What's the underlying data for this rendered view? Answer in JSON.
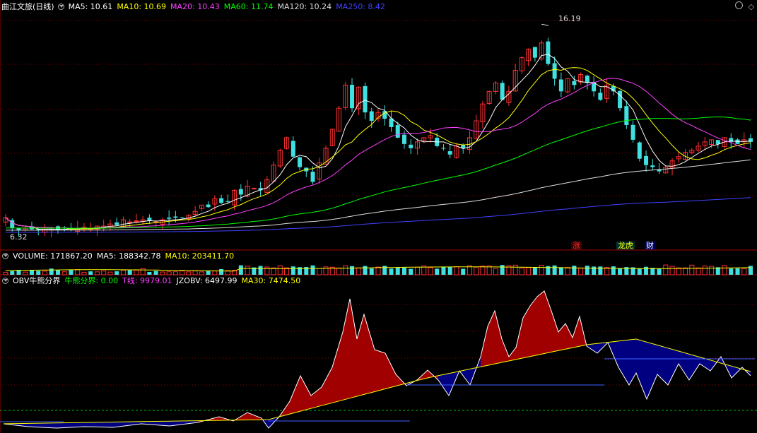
{
  "header": {
    "stock_name": "曲江文旅(日线)",
    "ma": [
      {
        "label": "MA5: 10.61",
        "color": "#ffffff"
      },
      {
        "label": "MA10: 10.69",
        "color": "#ffff00"
      },
      {
        "label": "MA20: 10.43",
        "color": "#ff40ff"
      },
      {
        "label": "MA60: 11.74",
        "color": "#00ff00"
      },
      {
        "label": "MA120: 10.24",
        "color": "#dddddd"
      },
      {
        "label": "MA250: 8.42",
        "color": "#4040ff"
      }
    ]
  },
  "volume_legend": [
    {
      "label": "VOLUME: 171867.20",
      "color": "#ffffff"
    },
    {
      "label": "MA5: 188342.78",
      "color": "#ffffff"
    },
    {
      "label": "MA10: 203411.70",
      "color": "#ffff00"
    }
  ],
  "obv_legend": [
    {
      "label": "OBV牛熊分界",
      "color": "#ffffff"
    },
    {
      "label": "牛熊分界: 0.00",
      "color": "#00ff00"
    },
    {
      "label": "T线: 9979.01",
      "color": "#ff40ff"
    },
    {
      "label": "JZOBV: 6497.99",
      "color": "#ffffff"
    },
    {
      "label": "MA30: 7474.50",
      "color": "#ffff00"
    }
  ],
  "annotations": {
    "high": "16.19",
    "low": "6.32",
    "events": [
      {
        "text": "涨",
        "color": "#ff3030",
        "bg": "#3a0000"
      },
      {
        "text": "龙虎",
        "color": "#ffff00",
        "bg": "#003030"
      },
      {
        "text": "财",
        "color": "#ffffff",
        "bg": "#000060"
      }
    ]
  },
  "colors": {
    "up": "#ff3030",
    "down": "#40e0e0",
    "grid": "#8b0000",
    "obv_up_fill": "#a00000",
    "obv_down_fill": "#000080"
  },
  "chart_data": {
    "type": "candlestick",
    "price_range": [
      6.0,
      16.6
    ],
    "closes": [
      7.0,
      6.5,
      6.4,
      6.5,
      6.45,
      6.4,
      6.5,
      6.45,
      6.4,
      6.5,
      6.45,
      6.5,
      6.55,
      6.5,
      6.6,
      6.6,
      6.7,
      6.65,
      6.9,
      6.8,
      6.85,
      6.9,
      6.85,
      6.8,
      6.9,
      6.95,
      7.0,
      7.0,
      7.1,
      7.3,
      7.6,
      7.5,
      7.9,
      7.7,
      7.75,
      8.3,
      8.1,
      8.5,
      8.4,
      8.3,
      8.8,
      9.5,
      10.2,
      10.8,
      9.9,
      9.4,
      9.2,
      8.7,
      9.6,
      10.3,
      11.2,
      12.2,
      13.3,
      12.2,
      13.2,
      12.0,
      11.6,
      12.0,
      11.7,
      11.3,
      10.8,
      10.5,
      10.3,
      10.6,
      10.8,
      10.9,
      10.4,
      10.3,
      10.0,
      10.4,
      10.3,
      10.8,
      11.6,
      12.4,
      13.0,
      13.4,
      12.6,
      13.0,
      14.0,
      14.6,
      15.0,
      14.6,
      15.3,
      14.3,
      13.6,
      13.0,
      13.6,
      13.3,
      13.8,
      13.4,
      13.0,
      12.6,
      13.3,
      13.0,
      12.2,
      11.4,
      10.7,
      9.8,
      9.5,
      9.4,
      9.2,
      9.4,
      9.7,
      9.9,
      10.1,
      10.2,
      10.4,
      10.6,
      10.7,
      10.5,
      10.8,
      10.6,
      10.5,
      10.7,
      10.6
    ],
    "ma_values": {
      "MA5": 10.61,
      "MA10": 10.69,
      "MA20": 10.43,
      "MA60": 11.74,
      "MA120": 10.24,
      "MA250": 8.42
    },
    "volume": {
      "last": 171867.2,
      "ma5": 188342.78,
      "ma10": 203411.7
    },
    "obv": {
      "bull_bear_line": 0.0,
      "t_line": 9979.01,
      "jzobv": 6497.99,
      "ma30": 7474.5
    }
  }
}
